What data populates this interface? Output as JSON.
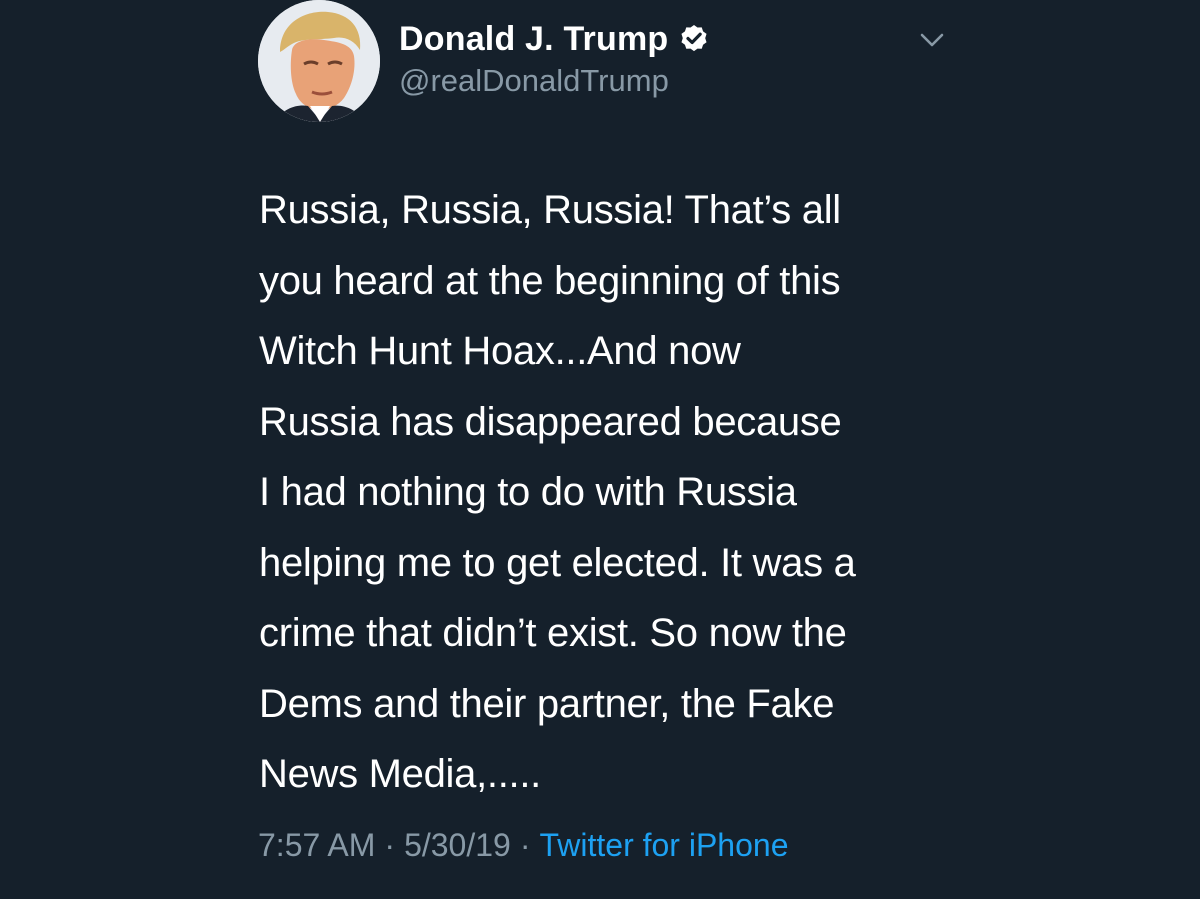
{
  "author": {
    "display_name": "Donald J. Trump",
    "handle": "@realDonaldTrump",
    "verified": true,
    "avatar_icon": "profile-photo"
  },
  "menu": {
    "icon": "chevron-down-icon"
  },
  "tweet": {
    "lines": [
      "Russia, Russia, Russia! That’s all",
      "you heard at the beginning of this",
      "Witch Hunt Hoax...And now",
      "Russia has disappeared because",
      "I had nothing to do with Russia",
      "helping me to get elected. It was a",
      "crime that didn’t exist. So now the",
      "Dems and their partner, the Fake",
      "News Media,....."
    ]
  },
  "meta": {
    "time": "7:57 AM",
    "date": "5/30/19",
    "separator": "·",
    "source": "Twitter for iPhone"
  },
  "colors": {
    "background": "#15202b",
    "primary_text": "#ffffff",
    "secondary_text": "#8899a6",
    "link": "#1da1f2"
  }
}
